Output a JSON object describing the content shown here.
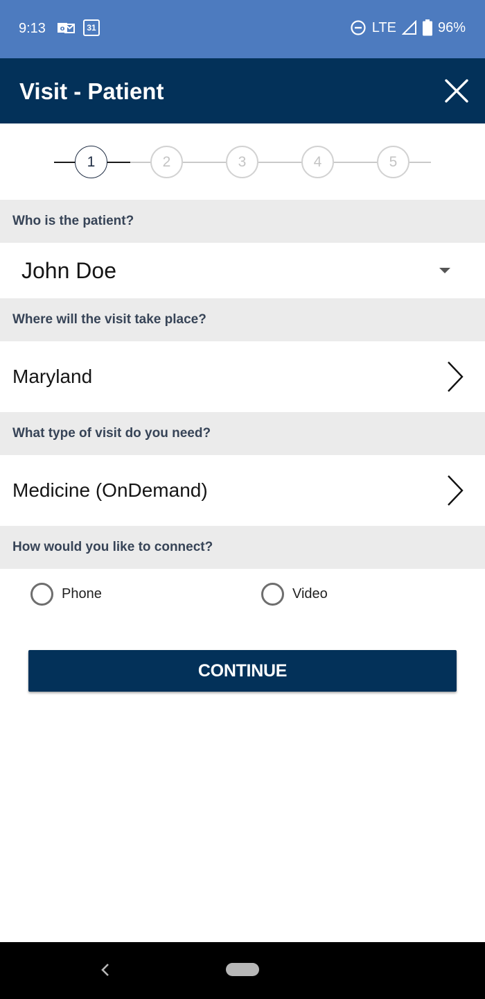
{
  "status_bar": {
    "time": "9:13",
    "network": "LTE",
    "battery": "96%",
    "icons": [
      "outlook-icon",
      "calendar-icon",
      "do-not-disturb-icon",
      "signal-icon",
      "battery-icon"
    ],
    "calendar_day": "31"
  },
  "header": {
    "title": "Visit - Patient",
    "close_icon": "close-icon",
    "background": "#033159"
  },
  "stepper": {
    "steps": [
      "1",
      "2",
      "3",
      "4",
      "5"
    ],
    "active_step": 1
  },
  "sections": {
    "patient": {
      "label": "Who is the patient?",
      "value": "John Doe"
    },
    "location": {
      "label": "Where will the visit take place?",
      "value": "Maryland"
    },
    "visit_type": {
      "label": "What type of visit do you need?",
      "value": "Medicine (OnDemand)"
    },
    "connect": {
      "label": "How would you like to connect?",
      "options": [
        "Phone",
        "Video"
      ],
      "selected": null
    }
  },
  "actions": {
    "continue_label": "CONTINUE"
  },
  "colors": {
    "status_bar": "#4d7bbf",
    "primary": "#033159",
    "section_bg": "#ebebeb"
  }
}
